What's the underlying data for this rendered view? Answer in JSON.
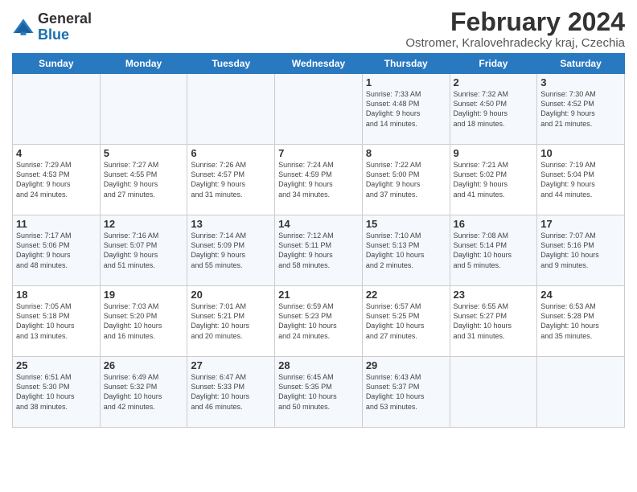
{
  "logo": {
    "line1": "General",
    "line2": "Blue"
  },
  "title": "February 2024",
  "subtitle": "Ostromer, Kralovehradecky kraj, Czechia",
  "days": [
    "Sunday",
    "Monday",
    "Tuesday",
    "Wednesday",
    "Thursday",
    "Friday",
    "Saturday"
  ],
  "weeks": [
    [
      {
        "date": "",
        "text": ""
      },
      {
        "date": "",
        "text": ""
      },
      {
        "date": "",
        "text": ""
      },
      {
        "date": "",
        "text": ""
      },
      {
        "date": "1",
        "text": "Sunrise: 7:33 AM\nSunset: 4:48 PM\nDaylight: 9 hours\nand 14 minutes."
      },
      {
        "date": "2",
        "text": "Sunrise: 7:32 AM\nSunset: 4:50 PM\nDaylight: 9 hours\nand 18 minutes."
      },
      {
        "date": "3",
        "text": "Sunrise: 7:30 AM\nSunset: 4:52 PM\nDaylight: 9 hours\nand 21 minutes."
      }
    ],
    [
      {
        "date": "4",
        "text": "Sunrise: 7:29 AM\nSunset: 4:53 PM\nDaylight: 9 hours\nand 24 minutes."
      },
      {
        "date": "5",
        "text": "Sunrise: 7:27 AM\nSunset: 4:55 PM\nDaylight: 9 hours\nand 27 minutes."
      },
      {
        "date": "6",
        "text": "Sunrise: 7:26 AM\nSunset: 4:57 PM\nDaylight: 9 hours\nand 31 minutes."
      },
      {
        "date": "7",
        "text": "Sunrise: 7:24 AM\nSunset: 4:59 PM\nDaylight: 9 hours\nand 34 minutes."
      },
      {
        "date": "8",
        "text": "Sunrise: 7:22 AM\nSunset: 5:00 PM\nDaylight: 9 hours\nand 37 minutes."
      },
      {
        "date": "9",
        "text": "Sunrise: 7:21 AM\nSunset: 5:02 PM\nDaylight: 9 hours\nand 41 minutes."
      },
      {
        "date": "10",
        "text": "Sunrise: 7:19 AM\nSunset: 5:04 PM\nDaylight: 9 hours\nand 44 minutes."
      }
    ],
    [
      {
        "date": "11",
        "text": "Sunrise: 7:17 AM\nSunset: 5:06 PM\nDaylight: 9 hours\nand 48 minutes."
      },
      {
        "date": "12",
        "text": "Sunrise: 7:16 AM\nSunset: 5:07 PM\nDaylight: 9 hours\nand 51 minutes."
      },
      {
        "date": "13",
        "text": "Sunrise: 7:14 AM\nSunset: 5:09 PM\nDaylight: 9 hours\nand 55 minutes."
      },
      {
        "date": "14",
        "text": "Sunrise: 7:12 AM\nSunset: 5:11 PM\nDaylight: 9 hours\nand 58 minutes."
      },
      {
        "date": "15",
        "text": "Sunrise: 7:10 AM\nSunset: 5:13 PM\nDaylight: 10 hours\nand 2 minutes."
      },
      {
        "date": "16",
        "text": "Sunrise: 7:08 AM\nSunset: 5:14 PM\nDaylight: 10 hours\nand 5 minutes."
      },
      {
        "date": "17",
        "text": "Sunrise: 7:07 AM\nSunset: 5:16 PM\nDaylight: 10 hours\nand 9 minutes."
      }
    ],
    [
      {
        "date": "18",
        "text": "Sunrise: 7:05 AM\nSunset: 5:18 PM\nDaylight: 10 hours\nand 13 minutes."
      },
      {
        "date": "19",
        "text": "Sunrise: 7:03 AM\nSunset: 5:20 PM\nDaylight: 10 hours\nand 16 minutes."
      },
      {
        "date": "20",
        "text": "Sunrise: 7:01 AM\nSunset: 5:21 PM\nDaylight: 10 hours\nand 20 minutes."
      },
      {
        "date": "21",
        "text": "Sunrise: 6:59 AM\nSunset: 5:23 PM\nDaylight: 10 hours\nand 24 minutes."
      },
      {
        "date": "22",
        "text": "Sunrise: 6:57 AM\nSunset: 5:25 PM\nDaylight: 10 hours\nand 27 minutes."
      },
      {
        "date": "23",
        "text": "Sunrise: 6:55 AM\nSunset: 5:27 PM\nDaylight: 10 hours\nand 31 minutes."
      },
      {
        "date": "24",
        "text": "Sunrise: 6:53 AM\nSunset: 5:28 PM\nDaylight: 10 hours\nand 35 minutes."
      }
    ],
    [
      {
        "date": "25",
        "text": "Sunrise: 6:51 AM\nSunset: 5:30 PM\nDaylight: 10 hours\nand 38 minutes."
      },
      {
        "date": "26",
        "text": "Sunrise: 6:49 AM\nSunset: 5:32 PM\nDaylight: 10 hours\nand 42 minutes."
      },
      {
        "date": "27",
        "text": "Sunrise: 6:47 AM\nSunset: 5:33 PM\nDaylight: 10 hours\nand 46 minutes."
      },
      {
        "date": "28",
        "text": "Sunrise: 6:45 AM\nSunset: 5:35 PM\nDaylight: 10 hours\nand 50 minutes."
      },
      {
        "date": "29",
        "text": "Sunrise: 6:43 AM\nSunset: 5:37 PM\nDaylight: 10 hours\nand 53 minutes."
      },
      {
        "date": "",
        "text": ""
      },
      {
        "date": "",
        "text": ""
      }
    ]
  ]
}
